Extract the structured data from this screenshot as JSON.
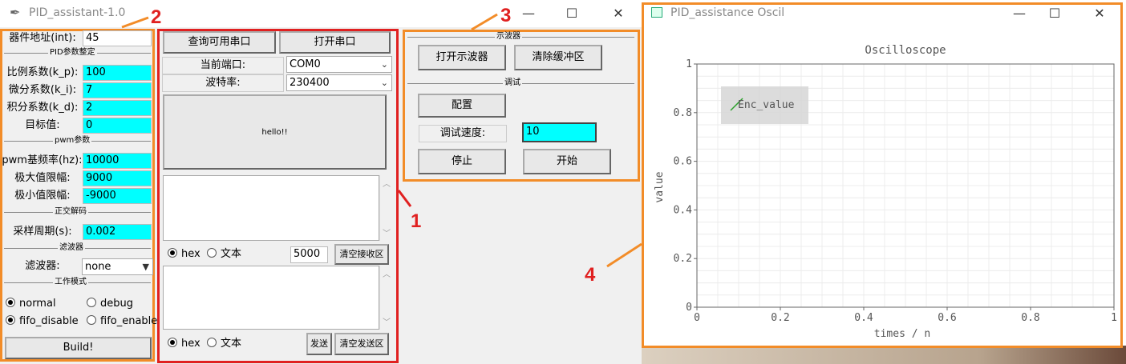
{
  "colors": {
    "orange": "#f28c28",
    "red": "#e02020",
    "cyan": "#00ffff",
    "accent_line": "#2ca02c"
  },
  "main_window": {
    "title": "PID_assistant-1.0",
    "icon": "feather-icon",
    "controls": {
      "minimize": "—",
      "maximize": "☐",
      "close": "✕"
    }
  },
  "left_panel": {
    "device_addr": {
      "label": "器件地址(int):",
      "value": "45"
    },
    "pid_section": "PID参数整定",
    "kp": {
      "label": "比例系数(k_p):",
      "value": "100"
    },
    "ki": {
      "label": "微分系数(k_i):",
      "value": "7"
    },
    "kd": {
      "label": "积分系数(k_d):",
      "value": "2"
    },
    "target": {
      "label": "目标值:",
      "value": "0"
    },
    "pwm_section": "pwm参数",
    "pwm_freq": {
      "label": "pwm基频率(hz):",
      "value": "10000"
    },
    "max_limit": {
      "label": "极大值限幅:",
      "value": "9000"
    },
    "min_limit": {
      "label": "极小值限幅:",
      "value": "-9000"
    },
    "quad_section": "正交解码",
    "sample": {
      "label": "采样周期(s):",
      "value": "0.002"
    },
    "filter_section": "滤波器",
    "filter": {
      "label": "滤波器:",
      "value": "none"
    },
    "mode_section": "工作模式",
    "modes": [
      "normal",
      "debug",
      "fifo_disable",
      "fifo_enable"
    ],
    "build_label": "Build!"
  },
  "serial_panel": {
    "query_ports": "查询可用串口",
    "open_port": "打开串口",
    "current_port_label": "当前端口:",
    "current_port_value": "COM0",
    "baud_label": "波特率:",
    "baud_value": "230400",
    "message": "hello!!",
    "rx": {
      "hex": "hex",
      "text": "文本",
      "count": "5000",
      "clear": "清空接收区"
    },
    "tx": {
      "hex": "hex",
      "text": "文本",
      "send": "发送",
      "clear": "清空发送区"
    }
  },
  "osc_panel": {
    "osc_section": "示波器",
    "open_osc": "打开示波器",
    "clear_buffer": "清除缓冲区",
    "debug_section": "调试",
    "config": "配置",
    "speed_label": "调试速度:",
    "speed_value": "10",
    "stop": "停止",
    "start": "开始"
  },
  "osc_window": {
    "title": "PID_assistance Oscil",
    "controls": {
      "minimize": "—",
      "maximize": "☐",
      "close": "✕"
    }
  },
  "annotations": {
    "n1": "1",
    "n2": "2",
    "n3": "3",
    "n4": "4"
  },
  "chart_data": {
    "type": "line",
    "title": "Oscilloscope",
    "xlabel": "times / n",
    "ylabel": "value",
    "xlim": [
      0,
      1
    ],
    "ylim": [
      0,
      1
    ],
    "xticks": [
      "0",
      "0.2",
      "0.4",
      "0.6",
      "0.8",
      "1"
    ],
    "yticks": [
      "0",
      "0.2",
      "0.4",
      "0.6",
      "0.8",
      "1"
    ],
    "grid": true,
    "legend_position": "top-left",
    "series": [
      {
        "name": "Enc_value",
        "x": [],
        "y": []
      }
    ]
  }
}
